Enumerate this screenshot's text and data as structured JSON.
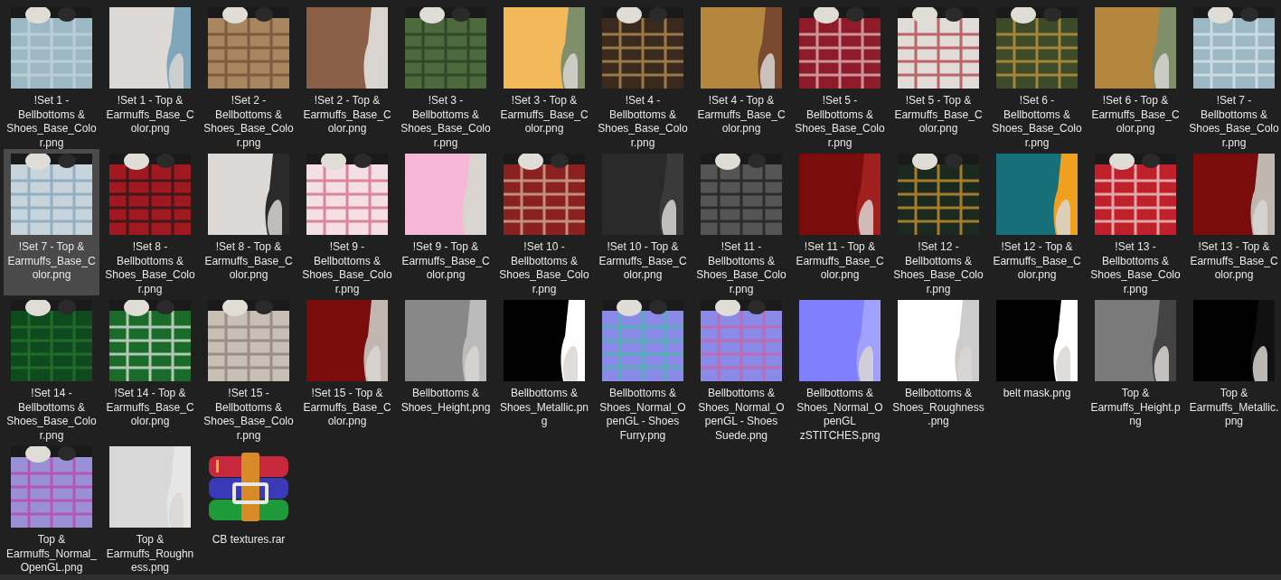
{
  "files": [
    {
      "name": "!Set 1 - Bellbottoms & Shoes_Base_Color.png",
      "selected": false
    },
    {
      "name": "!Set 1 - Top & Earmuffs_Base_Color.png",
      "selected": false
    },
    {
      "name": "!Set 2 - Bellbottoms & Shoes_Base_Color.png",
      "selected": false
    },
    {
      "name": "!Set 2 - Top & Earmuffs_Base_Color.png",
      "selected": false
    },
    {
      "name": "!Set 3 - Bellbottoms & Shoes_Base_Color.png",
      "selected": false
    },
    {
      "name": "!Set 3 - Top & Earmuffs_Base_Color.png",
      "selected": false
    },
    {
      "name": "!Set 4 - Bellbottoms & Shoes_Base_Color.png",
      "selected": false
    },
    {
      "name": "!Set 4 - Top & Earmuffs_Base_Color.png",
      "selected": false
    },
    {
      "name": "!Set 5 - Bellbottoms & Shoes_Base_Color.png",
      "selected": false
    },
    {
      "name": "!Set 5 - Top & Earmuffs_Base_Color.png",
      "selected": false
    },
    {
      "name": "!Set 6 - Bellbottoms & Shoes_Base_Color.png",
      "selected": false
    },
    {
      "name": "!Set 6 - Top & Earmuffs_Base_Color.png",
      "selected": false
    },
    {
      "name": "!Set 7 - Bellbottoms & Shoes_Base_Color.png",
      "selected": false
    },
    {
      "name": "!Set 7 - Top & Earmuffs_Base_Color.png",
      "selected": true
    },
    {
      "name": "!Set 8 - Bellbottoms & Shoes_Base_Color.png",
      "selected": false
    },
    {
      "name": "!Set 8 - Top & Earmuffs_Base_Color.png",
      "selected": false
    },
    {
      "name": "!Set 9 - Bellbottoms & Shoes_Base_Color.png",
      "selected": false
    },
    {
      "name": "!Set 9 - Top & Earmuffs_Base_Color.png",
      "selected": false
    },
    {
      "name": "!Set 10 - Bellbottoms & Shoes_Base_Color.png",
      "selected": false
    },
    {
      "name": "!Set 10 - Top & Earmuffs_Base_Color.png",
      "selected": false
    },
    {
      "name": "!Set 11 - Bellbottoms & Shoes_Base_Color.png",
      "selected": false
    },
    {
      "name": "!Set 11 - Top & Earmuffs_Base_Color.png",
      "selected": false
    },
    {
      "name": "!Set 12 - Bellbottoms & Shoes_Base_Color.png",
      "selected": false
    },
    {
      "name": "!Set 12 - Top & Earmuffs_Base_Color.png",
      "selected": false
    },
    {
      "name": "!Set 13 - Bellbottoms & Shoes_Base_Color.png",
      "selected": false
    },
    {
      "name": "!Set 13 - Top & Earmuffs_Base_Color.png",
      "selected": false
    },
    {
      "name": "!Set 14 - Bellbottoms & Shoes_Base_Color.png",
      "selected": false
    },
    {
      "name": "!Set 14 - Top & Earmuffs_Base_Color.png",
      "selected": false
    },
    {
      "name": "!Set 15 - Bellbottoms & Shoes_Base_Color.png",
      "selected": false
    },
    {
      "name": "!Set 15 - Top & Earmuffs_Base_Color.png",
      "selected": false
    },
    {
      "name": "Bellbottoms & Shoes_Height.png",
      "selected": false
    },
    {
      "name": "Bellbottoms & Shoes_Metallic.png",
      "selected": false
    },
    {
      "name": "Bellbottoms & Shoes_Normal_OpenGL - Shoes Furry.png",
      "selected": false
    },
    {
      "name": "Bellbottoms & Shoes_Normal_OpenGL - Shoes Suede.png",
      "selected": false
    },
    {
      "name": "Bellbottoms & Shoes_Normal_OpenGL zSTITCHES.png",
      "selected": false
    },
    {
      "name": "Bellbottoms & Shoes_Roughness.png",
      "selected": false
    },
    {
      "name": "belt mask.png",
      "selected": false
    },
    {
      "name": "Top & Earmuffs_Height.png",
      "selected": false
    },
    {
      "name": "Top & Earmuffs_Metallic.png",
      "selected": false
    },
    {
      "name": "Top & Earmuffs_Normal_OpenGL.png",
      "selected": false
    },
    {
      "name": "Top & Earmuffs_Roughness.png",
      "selected": false
    },
    {
      "name": "CB textures.rar",
      "kind": "archive",
      "selected": false
    }
  ]
}
